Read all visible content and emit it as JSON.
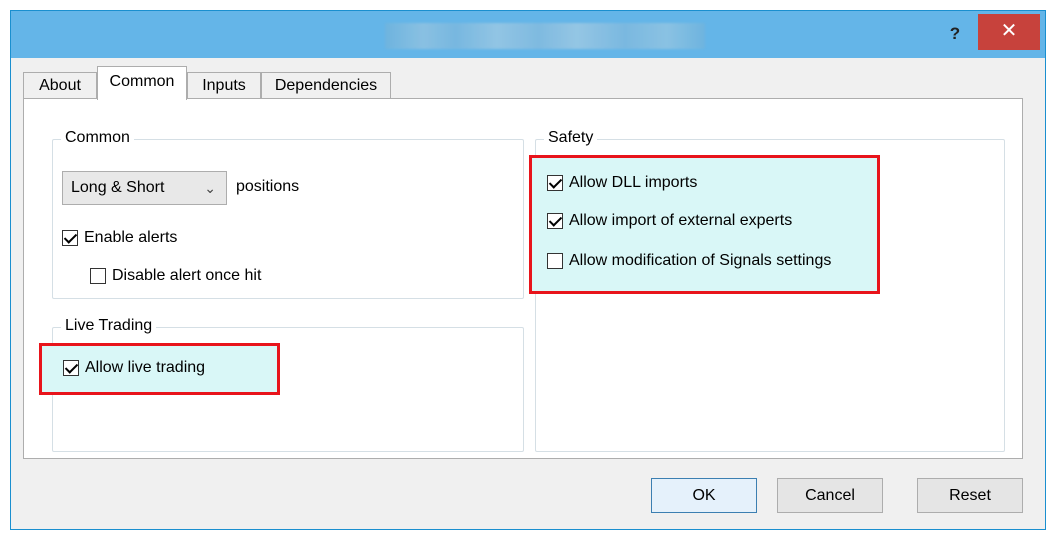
{
  "titlebar": {
    "help_label": "?",
    "close_label": "✕"
  },
  "tabs": [
    {
      "label": "About"
    },
    {
      "label": "Common",
      "active": true
    },
    {
      "label": "Inputs"
    },
    {
      "label": "Dependencies"
    }
  ],
  "common_group": {
    "title": "Common",
    "positions_select": {
      "value": "Long & Short",
      "suffix": "positions"
    },
    "enable_alerts": {
      "label": "Enable alerts",
      "checked": true
    },
    "disable_alert_once_hit": {
      "label": "Disable alert once hit",
      "checked": false
    }
  },
  "live_trading_group": {
    "title": "Live Trading",
    "allow_live_trading": {
      "label": "Allow live trading",
      "checked": true
    }
  },
  "safety_group": {
    "title": "Safety",
    "allow_dll_imports": {
      "label": "Allow DLL imports",
      "checked": true
    },
    "allow_import_external_experts": {
      "label": "Allow import of external experts",
      "checked": true
    },
    "allow_modification_signals": {
      "label": "Allow modification of Signals settings",
      "checked": false
    }
  },
  "buttons": {
    "ok": "OK",
    "cancel": "Cancel",
    "reset": "Reset"
  },
  "colors": {
    "titlebar": "#64b5e8",
    "close_button": "#c7423c",
    "highlight_fill": "#d9f7f7",
    "highlight_border": "#e8141b"
  }
}
